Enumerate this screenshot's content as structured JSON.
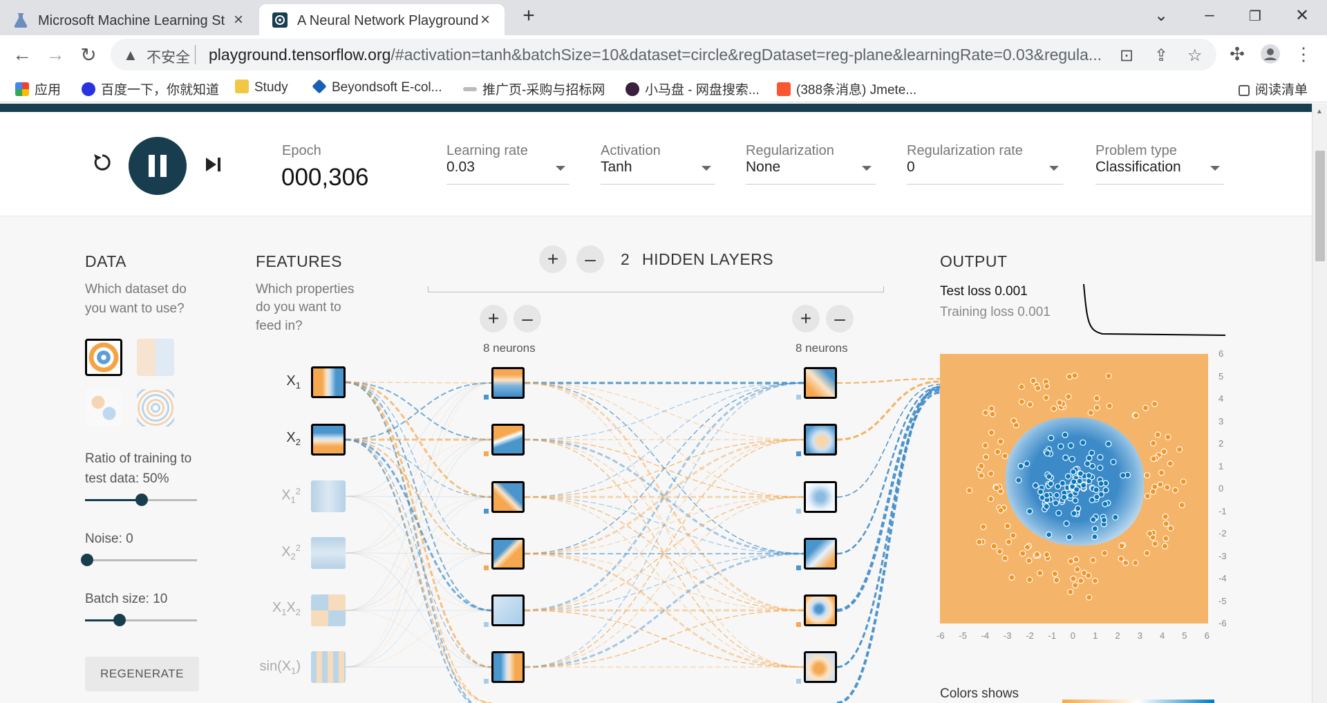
{
  "browser": {
    "tabs": [
      {
        "title": "Microsoft Machine Learning Stud",
        "active": false
      },
      {
        "title": "A Neural Network Playground",
        "active": true
      }
    ],
    "new_tab_symbol": "+",
    "address": {
      "security_text": "不安全",
      "host": "playground.tensorflow.org",
      "path": "/#activation=tanh&batchSize=10&dataset=circle&regDataset=reg-plane&learningRate=0.03&regula..."
    },
    "bookmarks": [
      {
        "label": "应用",
        "icon": "apps-grid-icon"
      },
      {
        "label": "百度一下，你就知道",
        "icon": "baidu-paw-icon"
      },
      {
        "label": "Study",
        "icon": "folder-icon"
      },
      {
        "label": "Beyondsoft E-col...",
        "icon": "beyondsoft-icon"
      },
      {
        "label": "推广页-采购与招标网",
        "icon": "site-icon"
      },
      {
        "label": "小马盘 - 网盘搜索...",
        "icon": "cat-icon"
      },
      {
        "label": "(388条消息) Jmete...",
        "icon": "csdn-c-icon"
      }
    ],
    "reading_list": "阅读清单"
  },
  "controls": {
    "epoch_label": "Epoch",
    "epoch_value": "000,306",
    "learning_rate": {
      "label": "Learning rate",
      "value": "0.03"
    },
    "activation": {
      "label": "Activation",
      "value": "Tanh"
    },
    "regularization": {
      "label": "Regularization",
      "value": "None"
    },
    "regularization_rate": {
      "label": "Regularization rate",
      "value": "0"
    },
    "problem_type": {
      "label": "Problem type",
      "value": "Classification"
    }
  },
  "data": {
    "title": "DATA",
    "question_l1": "Which dataset do",
    "question_l2": "you want to use?",
    "ratio_label_l1": "Ratio of training to",
    "ratio_label_l2": "test data:  50%",
    "ratio_value": 0.5,
    "noise_label": "Noise:  0",
    "noise_value": 0,
    "batch_label": "Batch size:  10",
    "batch_value": 0.3,
    "regenerate": "REGENERATE"
  },
  "features": {
    "title": "FEATURES",
    "question_l1": "Which properties",
    "question_l2": "do you want to",
    "question_l3": "feed in?",
    "items": [
      {
        "base": "X",
        "sub": "1",
        "sup": "",
        "active": true
      },
      {
        "base": "X",
        "sub": "2",
        "sup": "",
        "active": true
      },
      {
        "base": "X",
        "sub": "1",
        "sup": "2",
        "active": false
      },
      {
        "base": "X",
        "sub": "2",
        "sup": "2",
        "active": false
      },
      {
        "base": "X",
        "sub": "1",
        "base2": "X",
        "sub2": "2",
        "active": false
      },
      {
        "base": "sin(X",
        "sub": "1",
        "tail": ")",
        "active": false
      }
    ]
  },
  "network": {
    "plus": "+",
    "minus": "–",
    "hidden_layers_count": "2",
    "hidden_layers_label": "HIDDEN LAYERS",
    "layer1_neurons": "8 neurons",
    "layer2_neurons": "8 neurons"
  },
  "output": {
    "title": "OUTPUT",
    "test_loss": "Test loss 0.001",
    "training_loss": "Training loss 0.001",
    "y_ticks": [
      "6",
      "5",
      "4",
      "3",
      "2",
      "1",
      "0",
      "-1",
      "-2",
      "-3",
      "-4",
      "-5",
      "-6"
    ],
    "x_ticks": [
      "-6",
      "-5",
      "-4",
      "-3",
      "-2",
      "-1",
      "0",
      "1",
      "2",
      "3",
      "4",
      "5",
      "6"
    ],
    "colors_label": "Colors shows"
  },
  "colors": {
    "orange": "#f59322",
    "blue": "#0877bd",
    "dark": "#183d4e"
  }
}
